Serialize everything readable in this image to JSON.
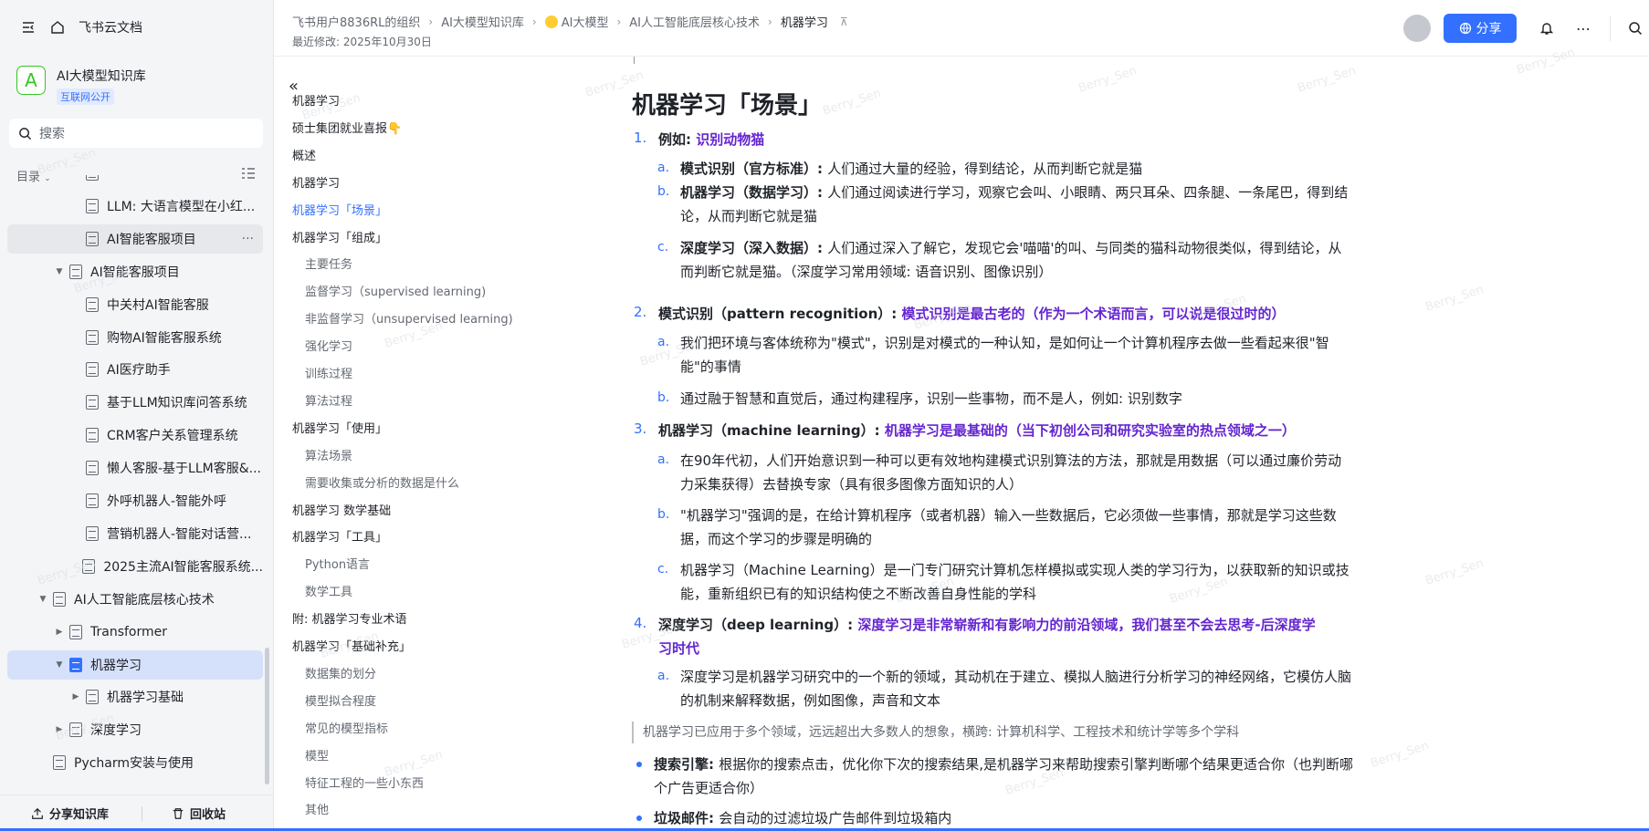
{
  "app": {
    "title": "飞书云文档",
    "watermark": "Berry_Sen"
  },
  "knowledge_base": {
    "logo": "A",
    "name": "AI大模型知识库",
    "badge": "互联网公开"
  },
  "search": {
    "placeholder": "搜索"
  },
  "toc": {
    "label": "目录"
  },
  "tree": [
    {
      "label": "",
      "level": 2,
      "arrow": "",
      "state": ""
    },
    {
      "label": "LLM: 大语言模型在小红...",
      "level": 2,
      "arrow": "",
      "state": ""
    },
    {
      "label": "AI智能客服项目",
      "level": 2,
      "arrow": "",
      "state": "sel"
    },
    {
      "label": "AI智能客服项目",
      "level": 1,
      "arrow": "▼",
      "state": ""
    },
    {
      "label": "中关村AI智能客服",
      "level": 2,
      "arrow": "",
      "state": ""
    },
    {
      "label": "购物AI智能客服系统",
      "level": 2,
      "arrow": "",
      "state": ""
    },
    {
      "label": "AI医疗助手",
      "level": 2,
      "arrow": "",
      "state": ""
    },
    {
      "label": "基于LLM知识库问答系统",
      "level": 2,
      "arrow": "",
      "state": ""
    },
    {
      "label": "CRM客户关系管理系统",
      "level": 2,
      "arrow": "",
      "state": ""
    },
    {
      "label": "懒人客服-基于LLM客服&...",
      "level": 2,
      "arrow": "",
      "state": ""
    },
    {
      "label": "外呼机器人-智能外呼",
      "level": 2,
      "arrow": "",
      "state": ""
    },
    {
      "label": "营销机器人-智能对话营...",
      "level": 2,
      "arrow": "",
      "state": ""
    },
    {
      "label": "2025主流AI智能客服系统...",
      "level": 2,
      "arrow": "",
      "state": ""
    },
    {
      "label": "AI人工智能底层核心技术",
      "level": 0,
      "arrow": "▼",
      "state": ""
    },
    {
      "label": "Transformer",
      "level": 1,
      "arrow": "▶",
      "state": ""
    },
    {
      "label": "机器学习",
      "level": 1,
      "arrow": "▼",
      "state": "active"
    },
    {
      "label": "机器学习基础",
      "level": 2,
      "arrow": "▶",
      "state": ""
    },
    {
      "label": "深度学习",
      "level": 1,
      "arrow": "▶",
      "state": ""
    },
    {
      "label": "Pycharm安装与使用",
      "level": 0,
      "arrow": "",
      "state": ""
    }
  ],
  "sidebar_footer": {
    "share_kb": "分享知识库",
    "recycle": "回收站"
  },
  "breadcrumb": [
    {
      "label": "飞书用户8836RL的组织",
      "emoji": false
    },
    {
      "label": "AI大模型知识库",
      "emoji": false
    },
    {
      "label": "AI大模型",
      "emoji": true
    },
    {
      "label": "AI人工智能底层核心技术",
      "emoji": false
    },
    {
      "label": "机器学习",
      "emoji": false,
      "current": true
    }
  ],
  "last_modified": "最近修改: 2025年10月30日",
  "header": {
    "share": "分享"
  },
  "outline": [
    {
      "label": "机器学习",
      "level": 1
    },
    {
      "label": "硕士集团就业喜报👇",
      "level": 1
    },
    {
      "label": "概述",
      "level": 1
    },
    {
      "label": "机器学习",
      "level": 1
    },
    {
      "label": "机器学习「场景」",
      "level": 1,
      "current": true
    },
    {
      "label": "机器学习「组成」",
      "level": 1
    },
    {
      "label": "主要任务",
      "level": 2
    },
    {
      "label": "监督学习（supervised learning)",
      "level": 2
    },
    {
      "label": "非监督学习（unsupervised learning)",
      "level": 2
    },
    {
      "label": "强化学习",
      "level": 2
    },
    {
      "label": "训练过程",
      "level": 2
    },
    {
      "label": "算法过程",
      "level": 2
    },
    {
      "label": "机器学习「使用」",
      "level": 1
    },
    {
      "label": "算法场景",
      "level": 2
    },
    {
      "label": "需要收集或分析的数据是什么",
      "level": 2
    },
    {
      "label": "机器学习 数学基础",
      "level": 1
    },
    {
      "label": "机器学习「工具」",
      "level": 1
    },
    {
      "label": "Python语言",
      "level": 2
    },
    {
      "label": "数学工具",
      "level": 2
    },
    {
      "label": "附: 机器学习专业术语",
      "level": 1
    },
    {
      "label": "机器学习「基础补充」",
      "level": 1
    },
    {
      "label": "数据集的划分",
      "level": 2
    },
    {
      "label": "模型拟合程度",
      "level": 2
    },
    {
      "label": "常见的模型指标",
      "level": 2
    },
    {
      "label": "模型",
      "level": 2
    },
    {
      "label": "特征工程的一些小东西",
      "level": 2
    },
    {
      "label": "其他",
      "level": 2
    }
  ],
  "doc": {
    "title": "机器学习「场景」",
    "items": [
      {
        "num": "1.",
        "bold": "例如: ",
        "hl": "识别动物猫",
        "rest": "",
        "subs": [
          {
            "mark": "a.",
            "bold": "模式识别（官方标准）: ",
            "text": "人们通过大量的经验，得到结论，从而判断它就是猫"
          },
          {
            "mark": "b.",
            "bold": "机器学习（数据学习）: ",
            "text": "人们通过阅读进行学习，观察它会叫、小眼睛、两只耳朵、四条腿、一条尾巴，得到结论，从而判断它就是猫"
          },
          {
            "mark": "c.",
            "bold": "深度学习（深入数据）: ",
            "text": "人们通过深入了解它，发现它会'喵喵'的叫、与同类的猫科动物很类似，得到结论，从而判断它就是猫。（深度学习常用领域: 语音识别、图像识别）"
          }
        ]
      },
      {
        "num": "2.",
        "bold": "模式识别（pattern recognition）: ",
        "hl": "模式识别是最古老的（作为一个术语而言，可以说是很过时的）",
        "rest": "",
        "subs": [
          {
            "mark": "a.",
            "bold": "",
            "text": "我们把环境与客体统称为\"模式\"，识别是对模式的一种认知，是如何让一个计算机程序去做一些看起来很\"智能\"的事情"
          },
          {
            "mark": "b.",
            "bold": "",
            "text": "通过融于智慧和直觉后，通过构建程序，识别一些事物，而不是人，例如: 识别数字"
          }
        ]
      },
      {
        "num": "3.",
        "bold": "机器学习（machine learning）: ",
        "hl": "机器学习是最基础的（当下初创公司和研究实验室的热点领域之一）",
        "rest": "",
        "subs": [
          {
            "mark": "a.",
            "bold": "",
            "text": "在90年代初，人们开始意识到一种可以更有效地构建模式识别算法的方法，那就是用数据（可以通过廉价劳动力采集获得）去替换专家（具有很多图像方面知识的人）"
          },
          {
            "mark": "b.",
            "bold": "",
            "text": "\"机器学习\"强调的是，在给计算机程序（或者机器）输入一些数据后，它必须做一些事情，那就是学习这些数据，而这个学习的步骤是明确的"
          },
          {
            "mark": "c.",
            "bold": "",
            "text": "机器学习（Machine Learning）是一门专门研究计算机怎样模拟或实现人类的学习行为，以获取新的知识或技能，重新组织已有的知识结构使之不断改善自身性能的学科"
          }
        ]
      },
      {
        "num": "4.",
        "bold": "深度学习（deep learning）: ",
        "hl": "深度学习是非常崭新和有影响力的前沿领域，我们甚至不会去思考-后深度学习时代",
        "rest": "",
        "subs": [
          {
            "mark": "a.",
            "bold": "",
            "text": "深度学习是机器学习研究中的一个新的领域，其动机在于建立、模拟人脑进行分析学习的神经网络，它模仿人脑的机制来解释数据，例如图像，声音和文本"
          }
        ]
      }
    ],
    "quote": "机器学习已应用于多个领域，远远超出大多数人的想象，横跨: 计算机科学、工程技术和统计学等多个学科",
    "bullets": [
      {
        "bold": "搜索引擎: ",
        "text": "根据你的搜索点击，优化你下次的搜索结果,是机器学习来帮助搜索引擎判断哪个结果更适合你（也判断哪个广告更适合你）"
      },
      {
        "bold": "垃圾邮件: ",
        "text": "会自动的过滤垃圾广告邮件到垃圾箱内"
      }
    ]
  }
}
